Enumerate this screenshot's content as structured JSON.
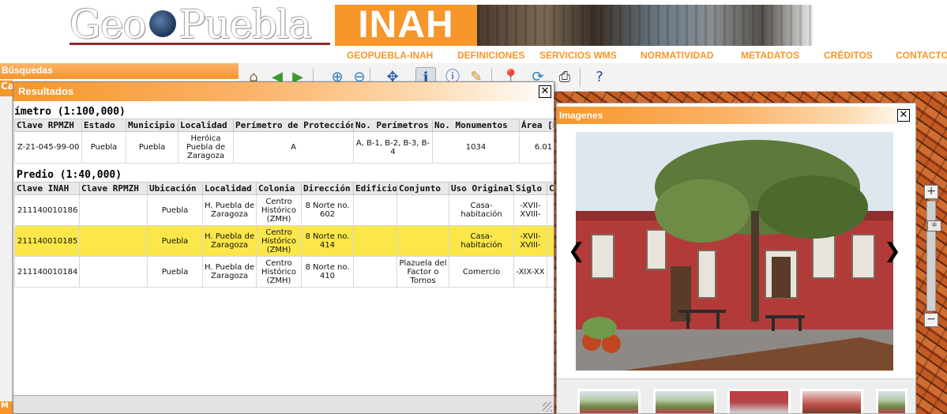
{
  "header": {
    "logo_geo": "Geo",
    "logo_puebla": "Puebla",
    "logo_inah": "INAH"
  },
  "nav": [
    {
      "label": "GEOPUEBLA-INAH"
    },
    {
      "label": "DEFINICIONES"
    },
    {
      "label": "SERVICIOS WMS"
    },
    {
      "label": "NORMATIVIDAD"
    },
    {
      "label": "METADATOS"
    },
    {
      "label": "CRÉDITOS"
    },
    {
      "label": "CONTACTO"
    }
  ],
  "left": {
    "busquedas_label": "Búsquedas",
    "tab2_label": "Ca",
    "tab3_label": "M"
  },
  "toolbar": {
    "tools": [
      {
        "icon": "house-icon",
        "glyph": "⌂",
        "color": "#8a6d2f"
      },
      {
        "icon": "arrow-left-icon",
        "glyph": "◀",
        "color": "#3c9a2c"
      },
      {
        "icon": "arrow-right-icon",
        "glyph": "▶",
        "color": "#3c9a2c"
      },
      {
        "icon": "zoom-in-icon",
        "glyph": "⊕",
        "color": "#2c7bb5"
      },
      {
        "icon": "zoom-out-icon",
        "glyph": "⊖",
        "color": "#2c7bb5"
      },
      {
        "icon": "pan-icon",
        "glyph": "✥",
        "color": "#2c5fa8"
      },
      {
        "icon": "identify-icon",
        "glyph": "ℹ",
        "color": "#1f4f9a"
      },
      {
        "icon": "info-icon",
        "glyph": "ⓘ",
        "color": "#1f4f9a"
      },
      {
        "icon": "measure-icon",
        "glyph": "✎",
        "color": "#c98b1c"
      },
      {
        "icon": "pin-icon",
        "glyph": "📍",
        "color": "#c0392b"
      },
      {
        "icon": "refresh-icon",
        "glyph": "⟳",
        "color": "#2c7bb5"
      },
      {
        "icon": "print-icon",
        "glyph": "⎙",
        "color": "#333333"
      },
      {
        "icon": "help-icon",
        "glyph": "?",
        "color": "#1f4f9a"
      }
    ]
  },
  "resultados": {
    "title": "Resultados",
    "close_glyph": "✕",
    "section1": {
      "title": "ímetro (1:100,000)",
      "headers": [
        "Clave RPMZH",
        "Estado",
        "Municipio",
        "Localidad",
        "Perímetro de Protección",
        "No. Perímetros",
        "No. Monumentos",
        "Área [k"
      ],
      "rows": [
        [
          "Z-21-045-99-00",
          "Puebla",
          "Puebla",
          "Heróica Puebla de Zaragoza",
          "A",
          "A, B-1, B-2, B-3, B-4",
          "1034",
          "6.01"
        ]
      ]
    },
    "section2": {
      "title": "Predio (1:40,000)",
      "headers": [
        "Clave INAH",
        "Clave RPMZH",
        "Ubicación",
        "Localidad",
        "Colonia",
        "Dirección",
        "Edificio",
        "Conjunto",
        "Uso Original",
        "Siglo",
        "C"
      ],
      "rows": [
        [
          "211140010186",
          "",
          "Puebla",
          "H. Puebla de Zaragoza",
          "Centro Histórico (ZMH)",
          "8 Norte no. 602",
          "",
          "",
          "Casa-habitación",
          "-XVII-XVIII-",
          ""
        ],
        [
          "211140010185",
          "",
          "Puebla",
          "H. Puebla de Zaragoza",
          "Centro Histórico (ZMH)",
          "8 Norte no. 414",
          "",
          "",
          "Casa-habitación",
          "-XVII-XVIII-",
          ""
        ],
        [
          "211140010184",
          "",
          "Puebla",
          "H. Puebla de Zaragoza",
          "Centro Histórico (ZMH)",
          "8 Norte no. 410",
          "",
          "Plazuela del Factor o Tornos",
          "Comercio",
          "-XIX-XX",
          ""
        ]
      ],
      "highlighted_row": 1
    }
  },
  "imagenes": {
    "title": "Imagenes",
    "close_glyph": "✕",
    "prev_glyph": "❮",
    "next_glyph": "❯"
  },
  "zoom": {
    "plus": "+",
    "minus": "−",
    "knob": "≑",
    "level": 0.03
  },
  "colors": {
    "accent": "#f7962a",
    "highlight_row": "#fbe749"
  }
}
